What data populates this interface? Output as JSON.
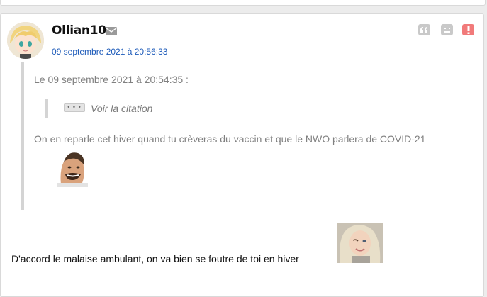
{
  "post": {
    "author": "Ollian10",
    "date": "09 septembre 2021 à 20:56:33",
    "quote": {
      "header": "Le 09 septembre 2021 à 20:54:35 :",
      "nested_expand_label": "• • •",
      "nested_link": "Voir la citation",
      "text": "On en reparle cet hiver quand tu crèveras du vaccin et que le NWO parlera de COVID-21"
    },
    "body": "D'accord le malaise ambulant, on va bien se foutre de toi en hiver"
  },
  "icons": {
    "message": "envelope-icon",
    "quote": "quote-icon",
    "dislike": "sad-face-icon",
    "report": "alert-icon"
  },
  "colors": {
    "date_link": "#1c5ab9",
    "report": "#f17a7a",
    "action_gray": "#c9c9c9",
    "quote_text": "#808080"
  }
}
